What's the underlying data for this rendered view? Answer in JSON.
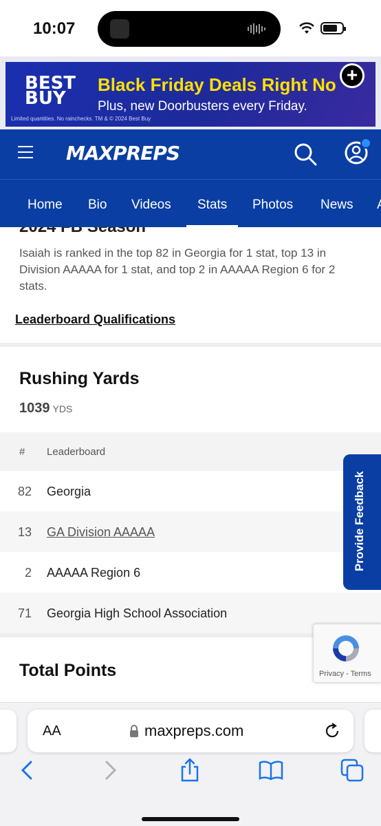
{
  "status_bar": {
    "time": "10:07"
  },
  "ad": {
    "brand": "BEST BUY",
    "headline": "Black Friday Deals Right No",
    "subline": "Plus, new Doorbusters every Friday.",
    "fine_print": "Limited quantities. No rainchecks. TM & © 2024 Best Buy"
  },
  "header": {
    "logo": "MAXPREPS"
  },
  "tabs": [
    "Home",
    "Bio",
    "Videos",
    "Stats",
    "Photos",
    "News",
    "A"
  ],
  "active_tab": "Stats",
  "content": {
    "clipped_title": "2024 FB Season",
    "rank_summary": "Isaiah is ranked in the top 82 in Georgia for 1 stat, top 13 in Division AAAAA for 1 stat, and top 2 in AAAAA Region 6 for 2 stats.",
    "leaderboard_link": "Leaderboard Qualifications",
    "stat": {
      "title": "Rushing Yards",
      "value": "1039",
      "unit": "YDS"
    },
    "table_headers": {
      "rank": "#",
      "name": "Leaderboard"
    },
    "rows": [
      {
        "rank": "82",
        "name": "Georgia"
      },
      {
        "rank": "13",
        "name": "GA Division AAAAA"
      },
      {
        "rank": "2",
        "name": "AAAAA Region 6"
      },
      {
        "rank": "71",
        "name": "Georgia High School Association"
      }
    ],
    "next_stat_title": "Total Points"
  },
  "feedback_label": "Provide Feedback",
  "recaptcha": {
    "text": "Privacy - Terms"
  },
  "browser": {
    "aa_label": "AA",
    "url": "maxpreps.com"
  }
}
